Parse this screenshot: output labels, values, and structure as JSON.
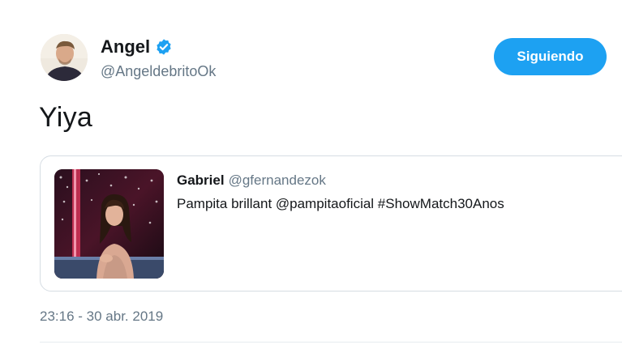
{
  "tweet": {
    "author": {
      "name": "Angel",
      "handle": "@AngeldebritoOk",
      "verified": true
    },
    "follow_button_label": "Siguiendo",
    "text": "Yiya",
    "timestamp": "23:16 - 30 abr. 2019"
  },
  "quoted_tweet": {
    "name": "Gabriel",
    "handle": "@gfernandezok",
    "text": "Pampita brillant @pampitaoficial #ShowMatch30Anos"
  },
  "colors": {
    "accent": "#1da1f2",
    "secondary_text": "#657786",
    "primary_text": "#14171a",
    "border": "#d6dde3"
  },
  "icons": {
    "verified": "verified-badge-icon"
  }
}
